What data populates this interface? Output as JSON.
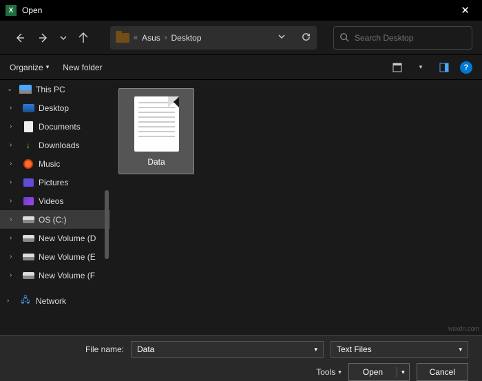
{
  "title": "Open",
  "breadcrumb": {
    "delim": "«",
    "crumb1": "Asus",
    "sep": "›",
    "crumb2": "Desktop"
  },
  "search": {
    "placeholder": "Search Desktop"
  },
  "toolbar": {
    "organize": "Organize",
    "newfolder": "New folder"
  },
  "sidebar": {
    "items": [
      {
        "label": "This PC",
        "expander": "⌄"
      },
      {
        "label": "Desktop",
        "expander": "›"
      },
      {
        "label": "Documents",
        "expander": "›"
      },
      {
        "label": "Downloads",
        "expander": "›"
      },
      {
        "label": "Music",
        "expander": "›"
      },
      {
        "label": "Pictures",
        "expander": "›"
      },
      {
        "label": "Videos",
        "expander": "›"
      },
      {
        "label": "OS (C:)",
        "expander": "›"
      },
      {
        "label": "New Volume (D",
        "expander": "›"
      },
      {
        "label": "New Volume (E",
        "expander": "›"
      },
      {
        "label": "New Volume (F",
        "expander": "›"
      },
      {
        "label": "Network",
        "expander": "›"
      }
    ]
  },
  "files": [
    {
      "name": "Data"
    }
  ],
  "footer": {
    "fname_label": "File name:",
    "fname_value": "Data",
    "filter_value": "Text Files",
    "tools": "Tools",
    "open": "Open",
    "cancel": "Cancel"
  },
  "watermark": "wsxdn.com"
}
